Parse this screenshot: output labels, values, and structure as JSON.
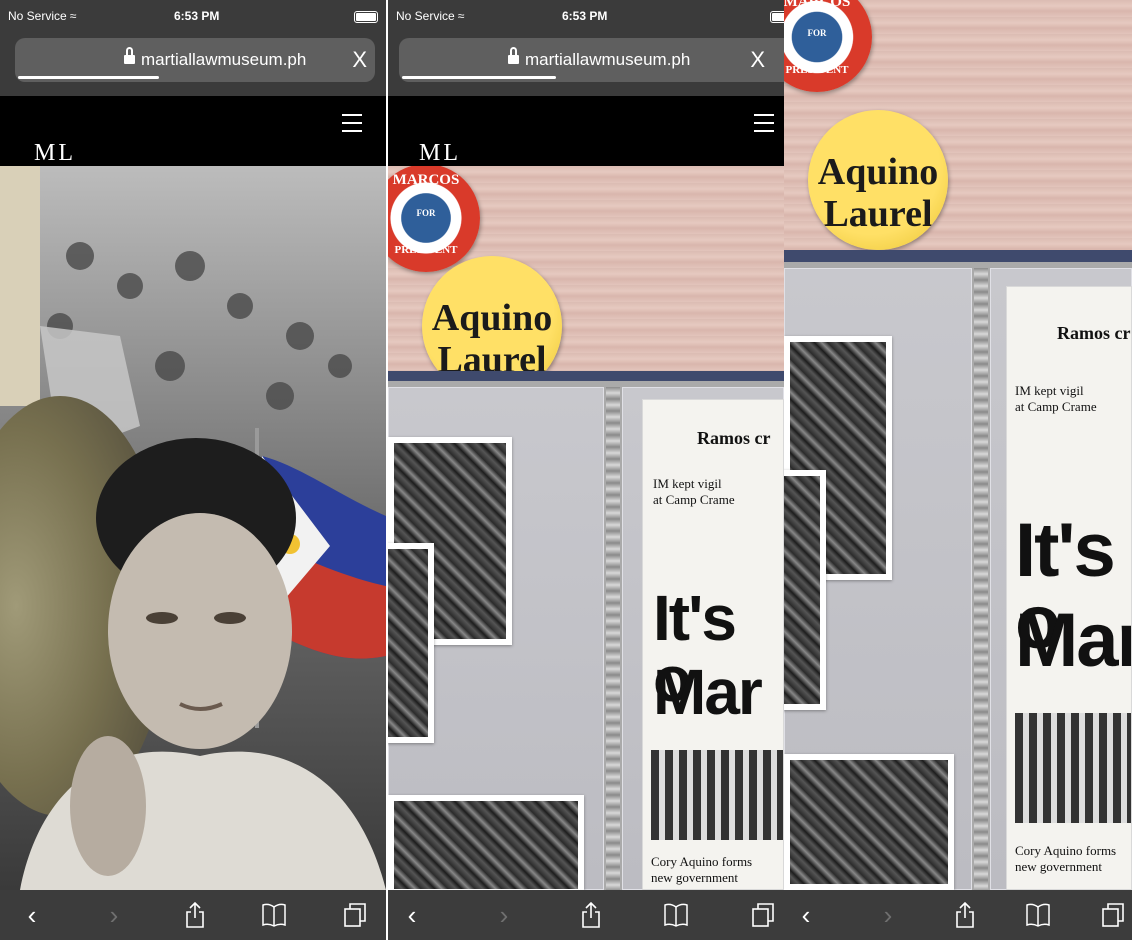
{
  "status_bar": {
    "carrier": "No Service",
    "time": "6:53 PM",
    "wifi_icon": "wifi-icon",
    "battery_icon": "battery-icon"
  },
  "browser": {
    "url": "martiallawmuseum.ph",
    "close_label": "X",
    "lock_icon": "lock-icon",
    "load_progress": 0.38
  },
  "site_header": {
    "logo": "ML",
    "menu_icon": "hamburger-menu-icon"
  },
  "panels": {
    "p2": {
      "pins": [
        "MARCOS",
        "FOR",
        "PRESIDENT",
        "Aquino",
        "Laurel"
      ],
      "news": [
        "Ramos cr",
        "IM kept vigil",
        "at Camp Crame",
        "It's o",
        "Mar",
        "Cory Aquino forms",
        "new government"
      ]
    },
    "p3": {
      "pins": [
        "MARCOS",
        "FOR",
        "PRESIDENT",
        "Aquino",
        "Laurel"
      ],
      "news": [
        "Ramos cr",
        "IM kept vigil",
        "at Camp Crame",
        "It's o",
        "Mar",
        "Cory Aquino forms",
        "new government"
      ]
    }
  },
  "toolbar": {
    "back_icon": "back-chevron-icon",
    "forward_icon": "forward-chevron-icon",
    "share_icon": "share-icon",
    "bookmarks_icon": "bookmarks-icon",
    "tabs_icon": "tabs-icon"
  }
}
